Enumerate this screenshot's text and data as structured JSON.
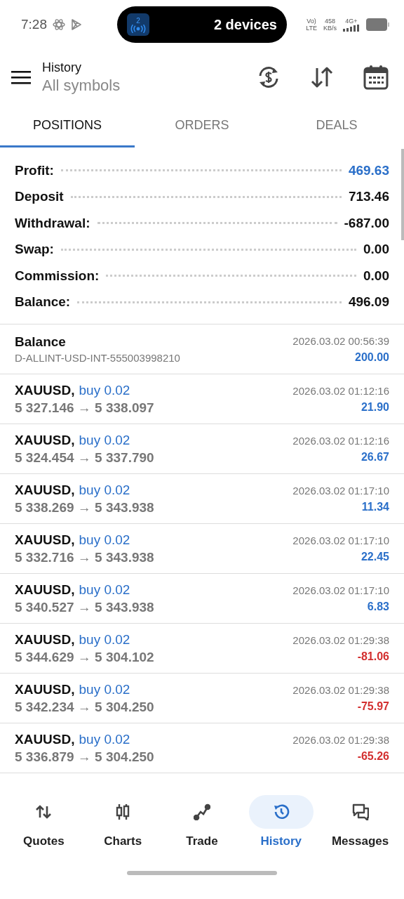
{
  "status_bar": {
    "time": "7:28",
    "pill_text": "2 devices",
    "pill_badge": "2",
    "network_top": "Vo)",
    "network_bottom": "LTE",
    "speed_value": "458",
    "speed_unit": "KB/s",
    "cell_type": "4G+"
  },
  "header": {
    "title": "History",
    "subtitle": "All symbols"
  },
  "tabs": [
    {
      "label": "POSITIONS",
      "selected": true
    },
    {
      "label": "ORDERS",
      "selected": false
    },
    {
      "label": "DEALS",
      "selected": false
    }
  ],
  "summary": [
    {
      "label": "Profit:",
      "value": "469.63",
      "highlight": true
    },
    {
      "label": "Deposit",
      "value": "713.46",
      "highlight": false
    },
    {
      "label": "Withdrawal:",
      "value": "-687.00",
      "highlight": false
    },
    {
      "label": "Swap:",
      "value": "0.00",
      "highlight": false
    },
    {
      "label": "Commission:",
      "value": "0.00",
      "highlight": false
    },
    {
      "label": "Balance:",
      "value": "496.09",
      "highlight": false
    }
  ],
  "deals": [
    {
      "kind": "balance",
      "symbol": "Balance",
      "detail": "D-ALLINT-USD-INT-555003998210",
      "time": "2026.03.02 00:56:39",
      "amount": "200.00",
      "color": "#2a6fc9"
    },
    {
      "kind": "trade",
      "symbol": "XAUUSD,",
      "side": "buy 0.02",
      "detail": "5 327.146 → 5 338.097",
      "time": "2026.03.02 01:12:16",
      "amount": "21.90",
      "color": "#2a6fc9"
    },
    {
      "kind": "trade",
      "symbol": "XAUUSD,",
      "side": "buy 0.02",
      "detail": "5 324.454 → 5 337.790",
      "time": "2026.03.02 01:12:16",
      "amount": "26.67",
      "color": "#2a6fc9"
    },
    {
      "kind": "trade",
      "symbol": "XAUUSD,",
      "side": "buy 0.02",
      "detail": "5 338.269 → 5 343.938",
      "time": "2026.03.02 01:17:10",
      "amount": "11.34",
      "color": "#2a6fc9"
    },
    {
      "kind": "trade",
      "symbol": "XAUUSD,",
      "side": "buy 0.02",
      "detail": "5 332.716 → 5 343.938",
      "time": "2026.03.02 01:17:10",
      "amount": "22.45",
      "color": "#2a6fc9"
    },
    {
      "kind": "trade",
      "symbol": "XAUUSD,",
      "side": "buy 0.02",
      "detail": "5 340.527 → 5 343.938",
      "time": "2026.03.02 01:17:10",
      "amount": "6.83",
      "color": "#2a6fc9"
    },
    {
      "kind": "trade",
      "symbol": "XAUUSD,",
      "side": "buy 0.02",
      "detail": "5 344.629 → 5 304.102",
      "time": "2026.03.02 01:29:38",
      "amount": "-81.06",
      "color": "#d32f2f"
    },
    {
      "kind": "trade",
      "symbol": "XAUUSD,",
      "side": "buy 0.02",
      "detail": "5 342.234 → 5 304.250",
      "time": "2026.03.02 01:29:38",
      "amount": "-75.97",
      "color": "#d32f2f"
    },
    {
      "kind": "trade",
      "symbol": "XAUUSD,",
      "side": "buy 0.02",
      "detail": "5 336.879 → 5 304.250",
      "time": "2026.03.02 01:29:38",
      "amount": "-65.26",
      "color": "#d32f2f"
    }
  ],
  "nav": [
    {
      "kind": "quotes",
      "label": "Quotes",
      "selected": false
    },
    {
      "kind": "charts",
      "label": "Charts",
      "selected": false
    },
    {
      "kind": "trade",
      "label": "Trade",
      "selected": false
    },
    {
      "kind": "history",
      "label": "History",
      "selected": true
    },
    {
      "kind": "messages",
      "label": "Messages",
      "selected": false
    }
  ]
}
